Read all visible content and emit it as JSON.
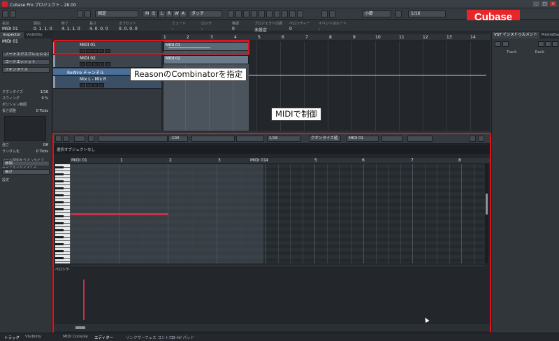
{
  "window": {
    "title": "Cubase Pro プロジェクト - 28.00",
    "controls": [
      "_",
      "□",
      "×"
    ]
  },
  "badge": {
    "text": "Cubase"
  },
  "toolbar": {
    "mode": "固定",
    "mode_buttons": [
      "M",
      "S",
      "L",
      "R",
      "W",
      "A"
    ],
    "touch": "タッチ",
    "grid_type": "小節",
    "quantize": "1/16"
  },
  "infoline": {
    "columns": [
      {
        "label": "名前",
        "value": "MIDI 01"
      },
      {
        "label": "開始",
        "value": "0. 1. 1. 0"
      },
      {
        "label": "終了",
        "value": "4. 1. 1. 0"
      },
      {
        "label": "長さ",
        "value": "4. 0. 0. 0"
      },
      {
        "label": "オフセット",
        "value": "0. 0. 0. 0"
      },
      {
        "label": "ミュート",
        "value": "-"
      },
      {
        "label": "ロック",
        "value": "-"
      },
      {
        "label": "移調",
        "value": "0"
      },
      {
        "label": "プロジェクトの調",
        "value": "未設定"
      },
      {
        "label": "ベロシティー",
        "value": "0"
      },
      {
        "label": "イベントのルート",
        "value": "-"
      }
    ]
  },
  "inspector": {
    "tabs": [
      "Inspector",
      "Visibility"
    ],
    "track_name": "MIDI 01",
    "sections": [
      "ノートエクスプレッション",
      "コードエディット",
      "クオンタイズ"
    ],
    "params": [
      {
        "label": "クオンタイズ",
        "value": "1/16"
      },
      {
        "label": "スウィング",
        "value": "0 %"
      },
      {
        "label": "ポジション範囲",
        "value": ""
      },
      {
        "label": "長さ調整",
        "value": "0 Ticks"
      },
      {
        "label": "強さ",
        "value": "Off"
      },
      {
        "label": "ランダム化",
        "value": "0 Ticks"
      }
    ],
    "bottom_items": [
      "ノート開始をクオンタイズ",
      "エンドをクオンタイズ",
      "クオンタイズを適用"
    ],
    "footer_sections": [
      "移調",
      "長さ",
      "設定"
    ]
  },
  "project": {
    "ruler_ticks": [
      "1",
      "2",
      "3",
      "4",
      "5",
      "6",
      "7",
      "8",
      "9",
      "10",
      "11",
      "12",
      "13",
      "14"
    ],
    "tracks": [
      {
        "name": "MIDI 01"
      },
      {
        "name": "MIDI 02"
      },
      {
        "name": "ReWire チャンネル"
      },
      {
        "name": "Mix L - Mix R"
      }
    ],
    "events": [
      {
        "label": "MIDI 01"
      },
      {
        "label": "MIDI 02"
      }
    ]
  },
  "right_panel": {
    "tabs": [
      "VST インストゥルメント",
      "MediaBay"
    ],
    "columns": [
      "Track",
      "Rack"
    ]
  },
  "editor": {
    "zoom_value": "-100",
    "quantize": "1/16",
    "quantize_preset": "クオンタイズ値",
    "part": "MIDI 01",
    "info_text": "選択オブジェクトなし",
    "ruler_ticks": [
      "MIDI 01",
      "1",
      "2",
      "3",
      "MIDI 01",
      "4",
      "5",
      "6",
      "7",
      "8"
    ],
    "velocity_label": "ベロシティー",
    "notes": [
      {
        "pitch_row": 14,
        "start_beat": 0.05,
        "length_beats": 2.0
      }
    ],
    "velocities": [
      {
        "beat": 0.05,
        "value": 0.75
      }
    ]
  },
  "annotations": {
    "combinator_callout": "ReasonのCombinatorを指定",
    "midi_callout": "MIDIで制御"
  },
  "bottom_tabs": [
    "トラック",
    "Visibility",
    "MIDI Console",
    "エディター",
    "リンクサーフェス コントロール",
    "コードパッド"
  ],
  "colors": {
    "annotation_red": "#e0141c",
    "note_color": "#c8304a",
    "badge_bg": "#e8262a"
  }
}
